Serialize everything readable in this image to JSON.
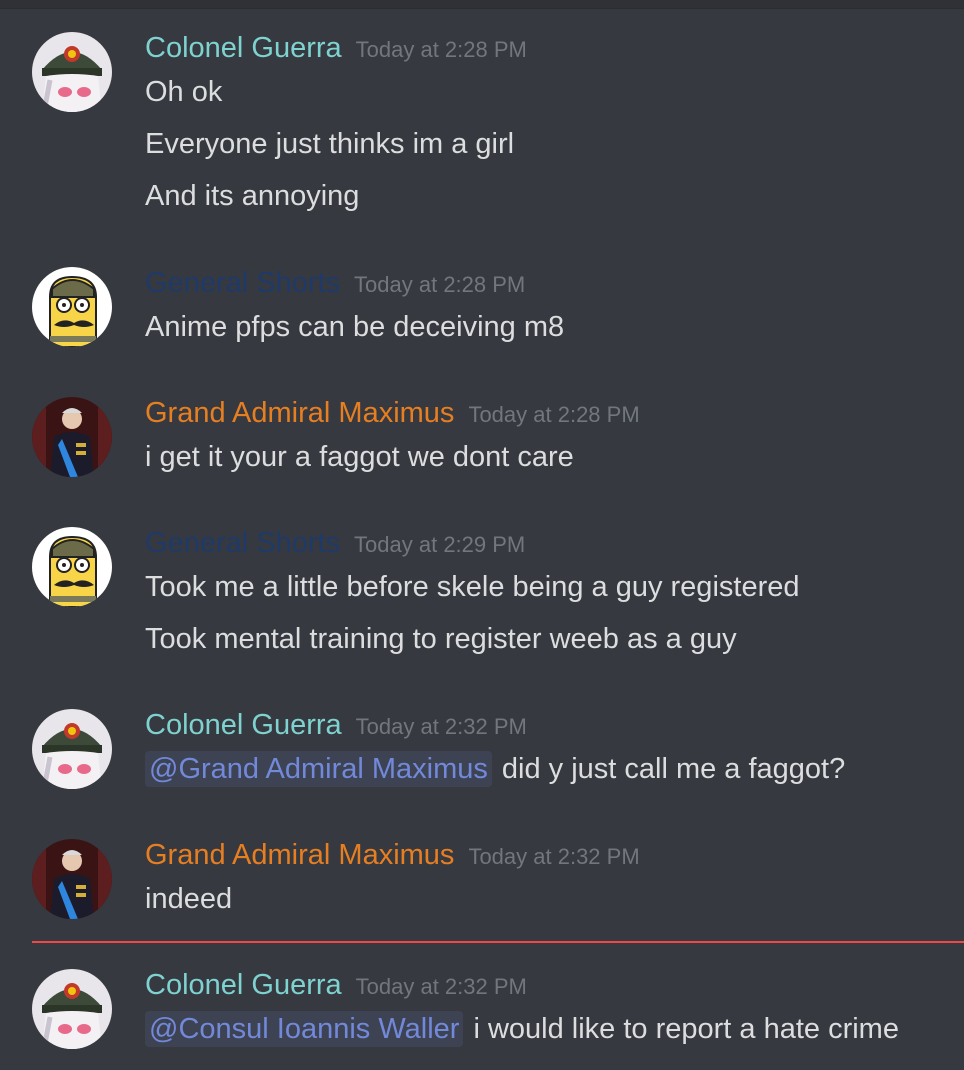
{
  "colors": {
    "colonel_guerra": "#7ed2d0",
    "general_shorts": "#1f3a68",
    "grand_admiral": "#e67e22",
    "mention": "#7289da",
    "new_messages_divider": "#f04747"
  },
  "messages": [
    {
      "author": "Colonel Guerra",
      "timestamp": "Today at 2:28 PM",
      "avatar_icon": "anime-officer-avatar-icon",
      "lines": [
        "Oh ok",
        "Everyone just thinks im a girl",
        "And its annoying"
      ]
    },
    {
      "author": "General Shorts",
      "timestamp": "Today at 2:28 PM",
      "avatar_icon": "cartoon-mustache-avatar-icon",
      "lines": [
        "Anime pfps can be deceiving m8"
      ]
    },
    {
      "author": "Grand Admiral Maximus",
      "timestamp": "Today at 2:28 PM",
      "avatar_icon": "royal-portrait-avatar-icon",
      "lines": [
        "i get it your a faggot we dont care"
      ]
    },
    {
      "author": "General Shorts",
      "timestamp": "Today at 2:29 PM",
      "avatar_icon": "cartoon-mustache-avatar-icon",
      "lines": [
        "Took me a little before skele being a guy registered",
        "Took mental training to register weeb as a guy"
      ]
    },
    {
      "author": "Colonel Guerra",
      "timestamp": "Today at 2:32 PM",
      "avatar_icon": "anime-officer-avatar-icon",
      "mention": "@Grand Admiral Maximus",
      "text": "did y just call me a faggot?"
    },
    {
      "author": "Grand Admiral Maximus",
      "timestamp": "Today at 2:32 PM",
      "avatar_icon": "royal-portrait-avatar-icon",
      "lines": [
        "indeed"
      ]
    },
    {
      "author": "Colonel Guerra",
      "timestamp": "Today at 2:32 PM",
      "avatar_icon": "anime-officer-avatar-icon",
      "mention": "@Consul Ioannis Waller",
      "text": "i would like to report a hate crime"
    }
  ]
}
